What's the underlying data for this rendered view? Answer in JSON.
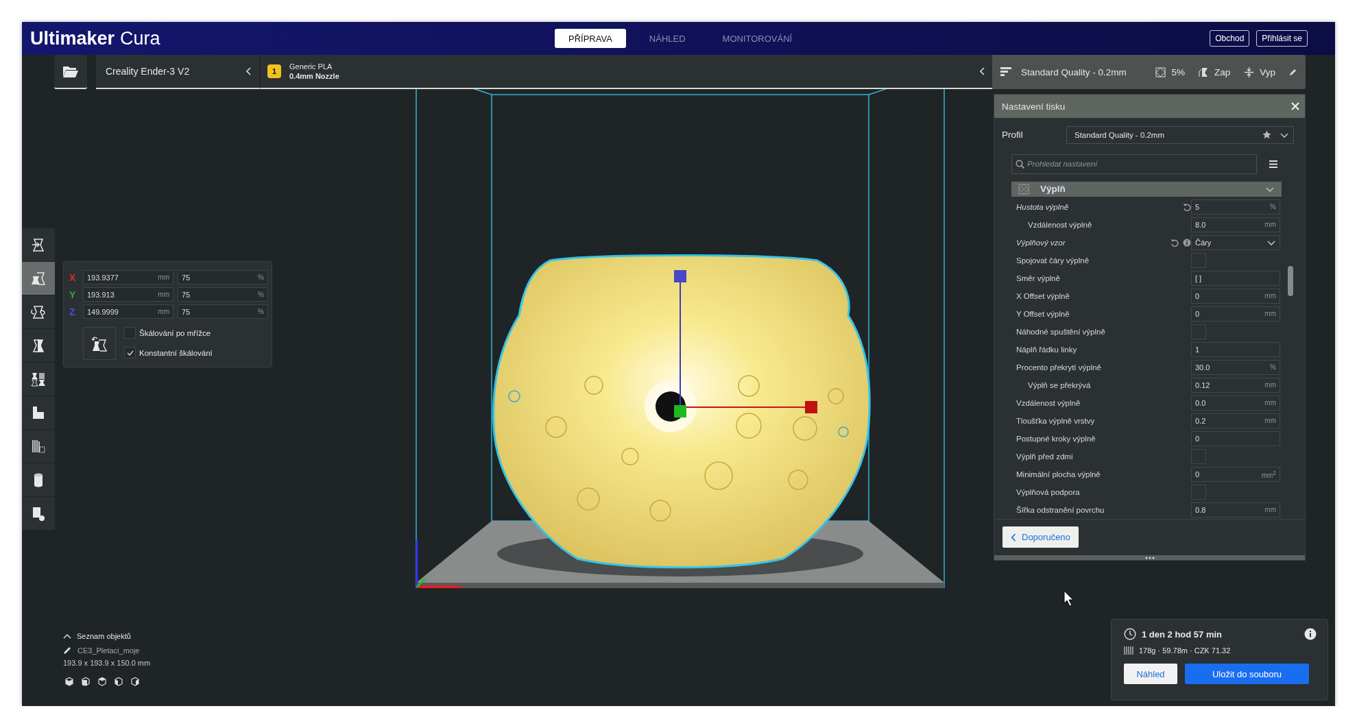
{
  "header": {
    "logo_bold": "Ultimaker",
    "logo_light": "Cura",
    "stages": [
      {
        "label": "PŘÍPRAVA",
        "selected": true
      },
      {
        "label": "NÁHLED",
        "selected": false
      },
      {
        "label": "MONITOROVÁNÍ",
        "selected": false
      }
    ],
    "buttons": [
      "Obchod",
      "Přihlásit se"
    ]
  },
  "printer_bar": {
    "printer": "Creality Ender-3 V2",
    "material_badge": "1",
    "material": "Generic PLA",
    "nozzle": "0.4mm Nozzle"
  },
  "print_setup_summary": {
    "profile": "Standard Quality - 0.2mm",
    "infill": "5%",
    "support": "Zap",
    "adhesion": "Vyp"
  },
  "tools": [
    {
      "kind": "move",
      "selected": false
    },
    {
      "kind": "scale",
      "selected": true
    },
    {
      "kind": "rotate",
      "selected": false
    },
    {
      "kind": "mirror",
      "selected": false
    },
    {
      "kind": "per_model",
      "selected": false
    },
    {
      "kind": "support_blocker",
      "selected": false
    },
    {
      "kind": "mesh_tools",
      "selected": false
    },
    {
      "kind": "cylinder",
      "selected": false
    },
    {
      "kind": "tab",
      "selected": false
    }
  ],
  "scale_panel": {
    "axes": [
      {
        "label": "X",
        "color": "#d32f2f",
        "size": "193.9377",
        "size_unit": "mm",
        "percent": "75",
        "percent_unit": "%"
      },
      {
        "label": "Y",
        "color": "#2eaa2e",
        "size": "193.913",
        "size_unit": "mm",
        "percent": "75",
        "percent_unit": "%"
      },
      {
        "label": "Z",
        "color": "#4a4ad8",
        "size": "149.9999",
        "size_unit": "mm",
        "percent": "75",
        "percent_unit": "%"
      }
    ],
    "checkboxes": [
      {
        "label": "Škálování po mřížce",
        "checked": false
      },
      {
        "label": "Konstantní škálování",
        "checked": true
      }
    ]
  },
  "settings_panel": {
    "title": "Nastavení tisku",
    "profile_label": "Profil",
    "profile": "Standard Quality - 0.2mm",
    "search_placeholder": "Prohledat nastavení",
    "category": "Výplň",
    "settings": [
      {
        "label": "Hustota výplně",
        "kind": "number",
        "value": "5",
        "unit": "%",
        "indented": false,
        "overridden": true,
        "info": false
      },
      {
        "label": "Vzdálenost výplně",
        "kind": "number",
        "value": "8.0",
        "unit": "mm",
        "indented": true,
        "overridden": false,
        "info": false
      },
      {
        "label": "Výplňový vzor",
        "kind": "dropdown",
        "value": "Čáry",
        "indented": false,
        "overridden": true,
        "info": true
      },
      {
        "label": "Spojovat čáry výplně",
        "kind": "checkbox",
        "checked": false,
        "indented": false,
        "overridden": false,
        "info": false
      },
      {
        "label": "Směr výplně",
        "kind": "number",
        "value": "[ ]",
        "indented": false,
        "overridden": false,
        "info": false
      },
      {
        "label": "X Offset výplně",
        "kind": "number",
        "value": "0",
        "unit": "mm",
        "indented": false,
        "overridden": false,
        "info": false
      },
      {
        "label": "Y Offset výplně",
        "kind": "number",
        "value": "0",
        "unit": "mm",
        "indented": false,
        "overridden": false,
        "info": false
      },
      {
        "label": "Náhodné spuštění výplně",
        "kind": "checkbox",
        "checked": false,
        "indented": false,
        "overridden": false,
        "info": false
      },
      {
        "label": "Náplň řádku linky",
        "kind": "number",
        "value": "1",
        "indented": false,
        "overridden": false,
        "info": false
      },
      {
        "label": "Procento překrytí výplně",
        "kind": "number",
        "value": "30.0",
        "unit": "%",
        "indented": false,
        "overridden": false,
        "info": false
      },
      {
        "label": "Výplň se překrývá",
        "kind": "number",
        "value": "0.12",
        "unit": "mm",
        "indented": true,
        "overridden": false,
        "info": false
      },
      {
        "label": "Vzdálenost výplně",
        "kind": "number",
        "value": "0.0",
        "unit": "mm",
        "indented": false,
        "overridden": false,
        "info": false
      },
      {
        "label": "Tloušťka výplně vrstvy",
        "kind": "number",
        "value": "0.2",
        "unit": "mm",
        "indented": false,
        "overridden": false,
        "info": false
      },
      {
        "label": "Postupné kroky výplně",
        "kind": "number",
        "value": "0",
        "indented": false,
        "overridden": false,
        "info": false
      },
      {
        "label": "Výplň před zdmi",
        "kind": "checkbox",
        "checked": false,
        "indented": false,
        "overridden": false,
        "info": false
      },
      {
        "label": "Minimální plocha výplně",
        "kind": "number",
        "value": "0",
        "unit": "mm$^{2}$",
        "indented": false,
        "overridden": false,
        "info": false
      },
      {
        "label": "Výplňová podpora",
        "kind": "checkbox",
        "checked": false,
        "indented": false,
        "overridden": false,
        "info": false
      },
      {
        "label": "Šířka odstranění povrchu",
        "kind": "number",
        "value": "0.8",
        "unit": "mm",
        "indented": false,
        "overridden": false,
        "info": false
      }
    ],
    "back_button": "Doporučeno"
  },
  "object_list": {
    "toggle": "Seznam objektů",
    "object": "CE3_Pletaci_moje",
    "dimensions": "193.9 x 193.9 x 150.0 mm"
  },
  "print_info": {
    "time": "1 den 2 hod 57 min",
    "material": "178g · 59.78m · CZK 71.32",
    "buttons": [
      {
        "label": "Náhled",
        "kind": "secondary"
      },
      {
        "label": "Uložit do souboru",
        "kind": "primary"
      }
    ]
  }
}
